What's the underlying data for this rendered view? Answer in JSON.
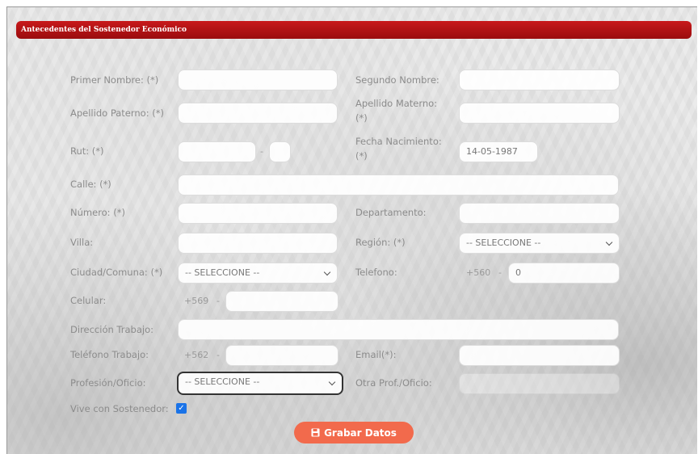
{
  "section": {
    "title": "Antecedentes del Sostenedor Económico"
  },
  "fields": {
    "primer_nombre": {
      "label": "Primer Nombre: (*)",
      "value": ""
    },
    "segundo_nombre": {
      "label": "Segundo Nombre:",
      "value": ""
    },
    "apellido_paterno": {
      "label": "Apellido Paterno: (*)",
      "value": ""
    },
    "apellido_materno": {
      "label_line1": "Apellido Materno:",
      "label_line2": "(*)",
      "value": ""
    },
    "rut": {
      "label": "Rut: (*)",
      "value": "",
      "dv": "",
      "separator": "-"
    },
    "fecha_nacimiento": {
      "label_line1": "Fecha Nacimiento:",
      "label_line2": "(*)",
      "value": "14-05-1987"
    },
    "calle": {
      "label": "Calle: (*)",
      "value": ""
    },
    "numero": {
      "label": "Número: (*)",
      "value": ""
    },
    "departamento": {
      "label": "Departamento:",
      "value": ""
    },
    "villa": {
      "label": "Villa:",
      "value": ""
    },
    "region": {
      "label": "Región: (*)",
      "selected": "-- SELECCIONE --"
    },
    "ciudad_comuna": {
      "label": "Ciudad/Comuna: (*)",
      "selected": "-- SELECCIONE --"
    },
    "telefono": {
      "label": "Telefono:",
      "prefix": "+560",
      "separator": "-",
      "value": "0"
    },
    "celular": {
      "label": "Celular:",
      "prefix": "+569",
      "separator": "-",
      "value": ""
    },
    "direccion_trabajo": {
      "label": "Dirección Trabajo:",
      "value": ""
    },
    "telefono_trabajo": {
      "label": "Teléfono Trabajo:",
      "prefix": "+562",
      "separator": "-",
      "value": ""
    },
    "email": {
      "label": "Email(*):",
      "value": ""
    },
    "profesion_oficio": {
      "label": "Profesión/Oficio:",
      "selected": "-- SELECCIONE --"
    },
    "otra_profesion": {
      "label": "Otra Prof./Oficio:",
      "value": ""
    },
    "vive_con_sostenedor": {
      "label": "Vive con Sostenedor:",
      "checked": true
    }
  },
  "actions": {
    "save_label": "Grabar Datos",
    "save_icon": "floppy-disk-icon"
  },
  "colors": {
    "header": "#b01214",
    "button": "#f26a4c",
    "checkbox": "#1a73e8"
  }
}
